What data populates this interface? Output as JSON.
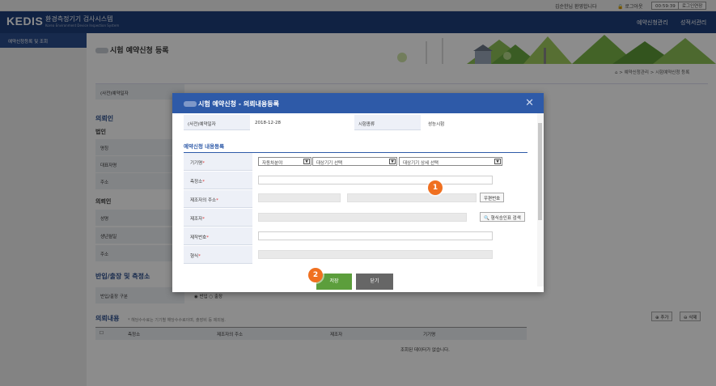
{
  "util": {
    "user": "김순한님 환영합니다",
    "logout": "로그아웃",
    "timer": "00:59:39",
    "extend": "로그인연장"
  },
  "header": {
    "logo": "KEDIS",
    "system_name": "환경측정기기 검사시스템",
    "system_name_en": "Korea Environment Device Inspection System",
    "nav": [
      "예약신청관리",
      "성적서관리"
    ]
  },
  "sidebar": {
    "items": [
      {
        "label": "예약신청등록 및 조회"
      }
    ]
  },
  "page": {
    "title": "시험 예약신청 등록",
    "breadcrumb": "> 예약신청관리 > 시험예약신청 등록"
  },
  "background": {
    "row1": {
      "label": "(사전)예약일자",
      "value": "2018-12-28",
      "label2": "시험종류",
      "value2": "성능시험"
    },
    "sec_client": "의뢰인",
    "sub_corp": "법인",
    "corp_rows": [
      "명칭",
      "대표자명",
      "주소"
    ],
    "sub_person": "의뢰인",
    "person_rows": [
      "성명",
      "생년월일",
      "주소"
    ],
    "sec_delivery": "반입/출장 및 측정소",
    "delivery_label": "반입/출장 구분",
    "delivery_opts": [
      "반입",
      "출장"
    ],
    "sec_content": "의뢰내용",
    "content_note": "* 해당수수료는 기기별 해당수수료이며, 출장비 등 제외됨.",
    "btn_add": "추가",
    "btn_delete": "삭제",
    "table_headers": [
      "측정소",
      "제조자의 주소",
      "제조자",
      "기기명"
    ],
    "empty_msg": "조회된 데이터가 없습니다."
  },
  "modal": {
    "title": "시험 예약신청 - 의뢰내용등록",
    "top": {
      "label1": "(사전)예약일자",
      "value1": "2018-12-28",
      "label2": "시험종류",
      "value2": "성능시험"
    },
    "section": "예약신청 내용등록",
    "fields": {
      "device": "기기명",
      "station": "측정소",
      "maker_addr": "제조자의 주소",
      "maker": "제조자",
      "serial": "제작번호",
      "model": "형식"
    },
    "selects": [
      "자동차분야",
      "대상기기 선택",
      "대상기기 상세 선택"
    ],
    "zip_btn": "우편번호",
    "search_btn": "형식승인표 검색",
    "save": "저장",
    "close": "닫기"
  },
  "badges": [
    "1",
    "2"
  ],
  "colors": {
    "header": "#1e3e7b",
    "modal_header": "#2e5aa8",
    "save": "#5c9e3c",
    "badge": "#f07020"
  }
}
